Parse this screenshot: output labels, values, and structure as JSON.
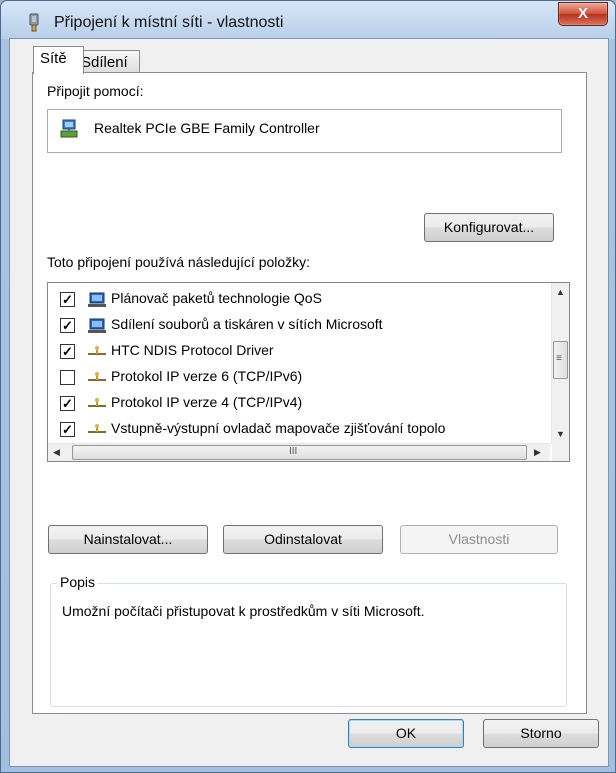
{
  "window": {
    "title": "Připojení k místní síti - vlastnosti",
    "close_label": "X"
  },
  "tabs": [
    {
      "label": "Sítě",
      "active": true
    },
    {
      "label": "Sdílení",
      "active": false
    }
  ],
  "connect_using": {
    "label": "Připojit pomocí:",
    "adapter": "Realtek PCIe GBE Family Controller",
    "configure_label": "Konfigurovat..."
  },
  "items_section": {
    "label": "Toto připojení používá následující položky:",
    "items": [
      {
        "label": "Plánovač paketů technologie QoS",
        "checked": true,
        "icon": "computer-icon"
      },
      {
        "label": "Sdílení souborů a tiskáren v sítích Microsoft",
        "checked": true,
        "icon": "computer-icon"
      },
      {
        "label": "HTC NDIS Protocol Driver",
        "checked": true,
        "icon": "protocol-icon"
      },
      {
        "label": "Protokol IP verze 6 (TCP/IPv6)",
        "checked": false,
        "icon": "protocol-icon"
      },
      {
        "label": "Protokol IP verze 4 (TCP/IPv4)",
        "checked": true,
        "icon": "protocol-icon"
      },
      {
        "label": "Vstupně-výstupní ovladač mapovače zjišťování topolo",
        "checked": true,
        "icon": "protocol-icon"
      }
    ],
    "hscroll_grip": "III",
    "vscroll_grip": "≡"
  },
  "actions": {
    "install": "Nainstalovat...",
    "uninstall": "Odinstalovat",
    "properties": "Vlastnosti"
  },
  "description": {
    "title": "Popis",
    "text": "Umožní počítači přistupovat k prostředkům v síti Microsoft."
  },
  "footer": {
    "ok": "OK",
    "cancel": "Storno"
  }
}
